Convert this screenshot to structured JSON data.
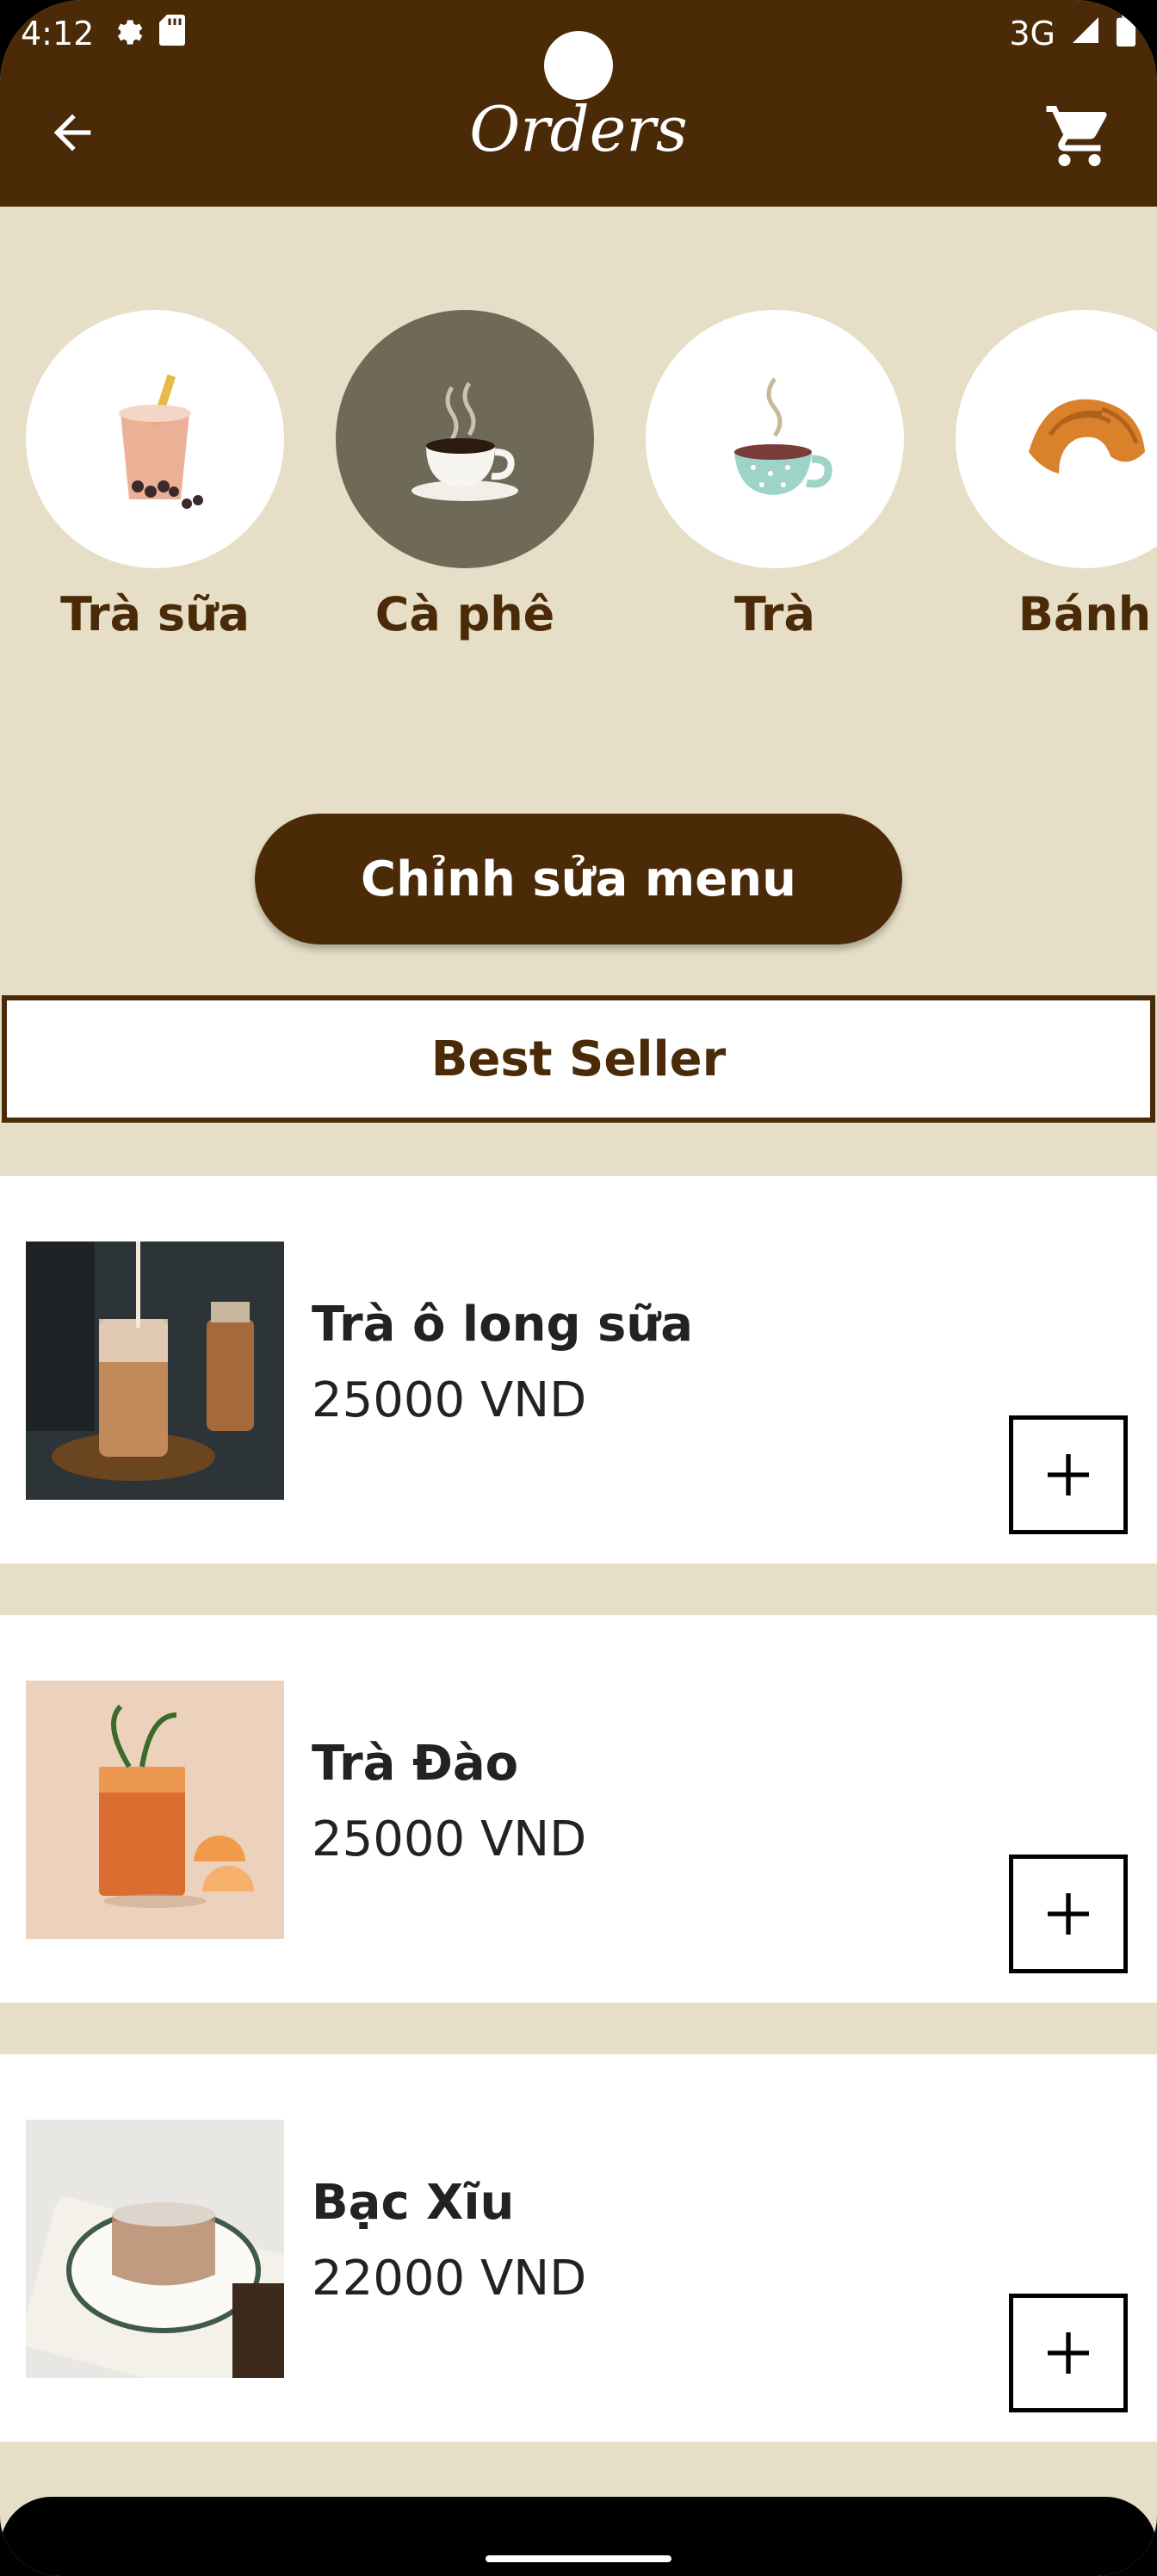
{
  "status_bar": {
    "time": "4:12",
    "network": "3G"
  },
  "header": {
    "title": "Orders"
  },
  "categories": [
    {
      "label": "Trà sữa",
      "icon": "bubble-tea-icon",
      "selected": false
    },
    {
      "label": "Cà phê",
      "icon": "coffee-cup-icon",
      "selected": true
    },
    {
      "label": "Trà",
      "icon": "tea-cup-icon",
      "selected": false
    },
    {
      "label": "Bánh",
      "icon": "croissant-icon",
      "selected": false
    }
  ],
  "edit_menu_label": "Chỉnh sửa menu",
  "section_title": "Best Seller",
  "products": [
    {
      "name": "Trà ô long sữa",
      "price": "25000 VND"
    },
    {
      "name": "Trà Đào",
      "price": "25000 VND"
    },
    {
      "name": "Bạc Xĩu",
      "price": "22000 VND"
    }
  ],
  "colors": {
    "primary": "#4a2a07",
    "background": "#e6dec6",
    "selected_category": "#6f6a58"
  }
}
